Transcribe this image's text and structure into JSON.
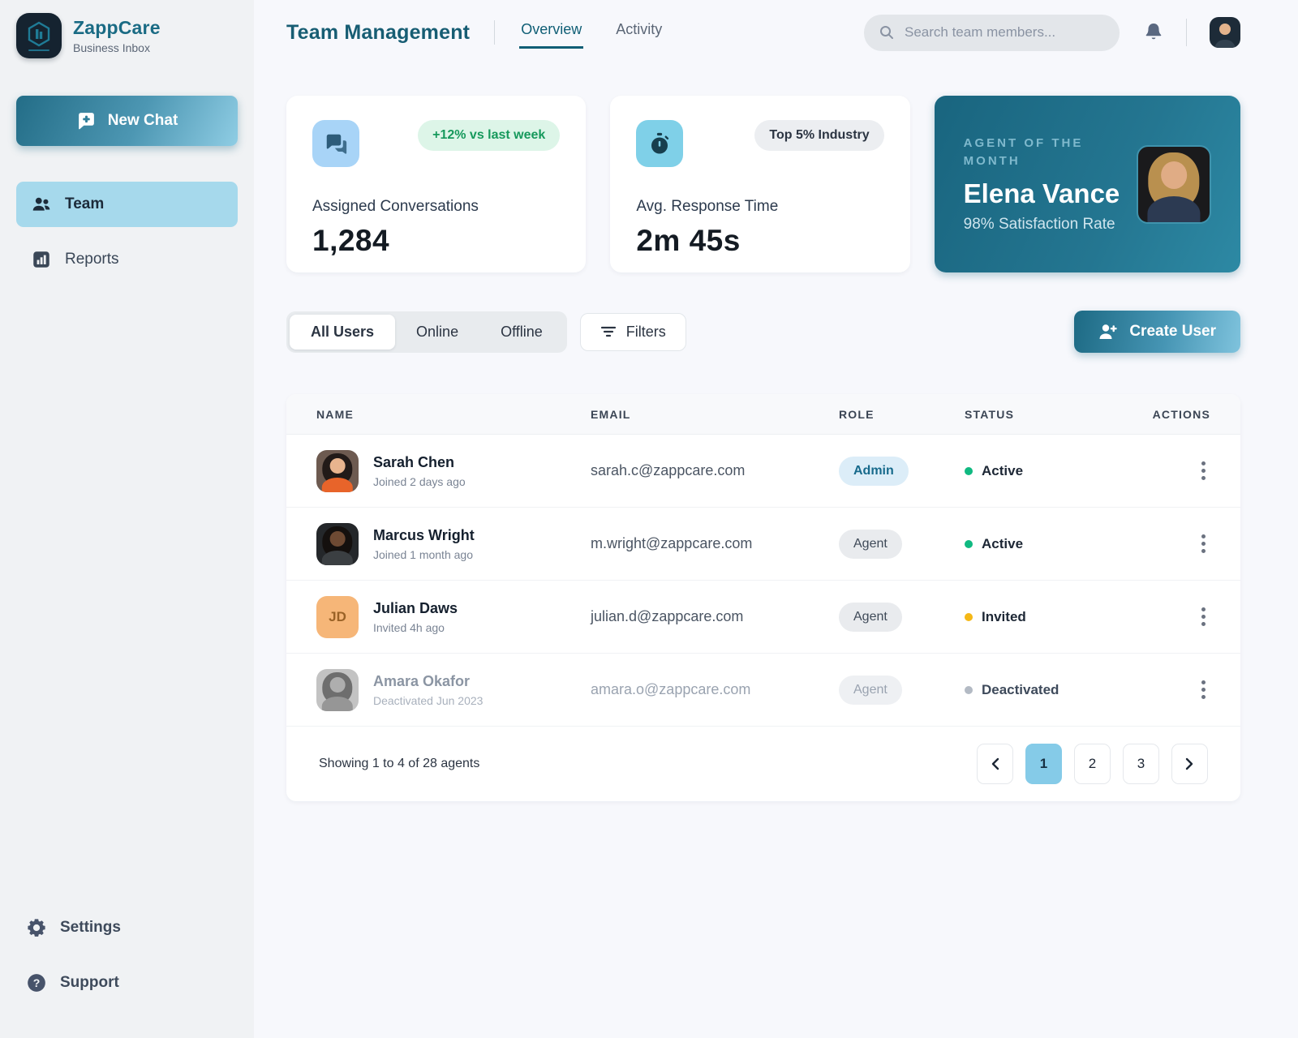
{
  "colors": {
    "accent_teal": "#1d6a84",
    "accent_gradient_light": "#8fcde4",
    "sidebar_bg": "#f0f2f4",
    "main_bg": "#f7f8fc",
    "active_nav_bg": "#a6d9ec",
    "status_active": "#10b981",
    "status_invited": "#f5b816",
    "status_deactivated": "#b3bac4",
    "badge_green_text": "#16995c",
    "heading_teal": "#175d73"
  },
  "sidebar": {
    "brand": {
      "name": "ZappCare",
      "subtitle": "Business Inbox"
    },
    "new_chat_label": "New Chat",
    "items": [
      {
        "label": "Team",
        "icon": "team-icon",
        "active": true
      },
      {
        "label": "Reports",
        "icon": "reports-icon",
        "active": false
      }
    ],
    "footer_items": [
      {
        "label": "Settings",
        "icon": "gear-icon"
      },
      {
        "label": "Support",
        "icon": "help-icon"
      }
    ]
  },
  "header": {
    "title": "Team Management",
    "tabs": [
      {
        "label": "Overview",
        "active": true
      },
      {
        "label": "Activity",
        "active": false
      }
    ],
    "search_placeholder": "Search team members...",
    "icons": [
      "search-icon",
      "bell-icon",
      "user-avatar"
    ]
  },
  "stats": [
    {
      "label": "Assigned Conversations",
      "value": "1,284",
      "badge": "+12% vs last week",
      "badge_style": "green",
      "icon": "chat-bubbles-icon"
    },
    {
      "label": "Avg. Response Time",
      "value": "2m 45s",
      "badge": "Top 5% Industry",
      "badge_style": "gray",
      "icon": "stopwatch-icon"
    }
  ],
  "agent_of_month": {
    "eyebrow": "AGENT OF THE MONTH",
    "name": "Elena Vance",
    "subtitle": "98% Satisfaction Rate"
  },
  "filters": {
    "tabs": [
      {
        "label": "All Users",
        "active": true
      },
      {
        "label": "Online",
        "active": false
      },
      {
        "label": "Offline",
        "active": false
      }
    ],
    "filters_label": "Filters",
    "create_user_label": "Create User"
  },
  "table": {
    "columns": [
      "NAME",
      "EMAIL",
      "ROLE",
      "STATUS",
      "ACTIONS"
    ],
    "rows": [
      {
        "name": "Sarah Chen",
        "meta": "Joined 2 days ago",
        "email": "sarah.c@zappcare.com",
        "role": "Admin",
        "status": "Active"
      },
      {
        "name": "Marcus Wright",
        "meta": "Joined 1 month ago",
        "email": "m.wright@zappcare.com",
        "role": "Agent",
        "status": "Active"
      },
      {
        "name": "Julian Daws",
        "meta": "Invited 4h ago",
        "email": "julian.d@zappcare.com",
        "role": "Agent",
        "status": "Invited",
        "initials": "JD"
      },
      {
        "name": "Amara Okafor",
        "meta": "Deactivated Jun 2023",
        "email": "amara.o@zappcare.com",
        "role": "Agent",
        "status": "Deactivated"
      }
    ],
    "pagination": {
      "summary": "Showing 1 to 4 of 28 agents",
      "pages": [
        "1",
        "2",
        "3"
      ],
      "active_page": "1"
    }
  }
}
